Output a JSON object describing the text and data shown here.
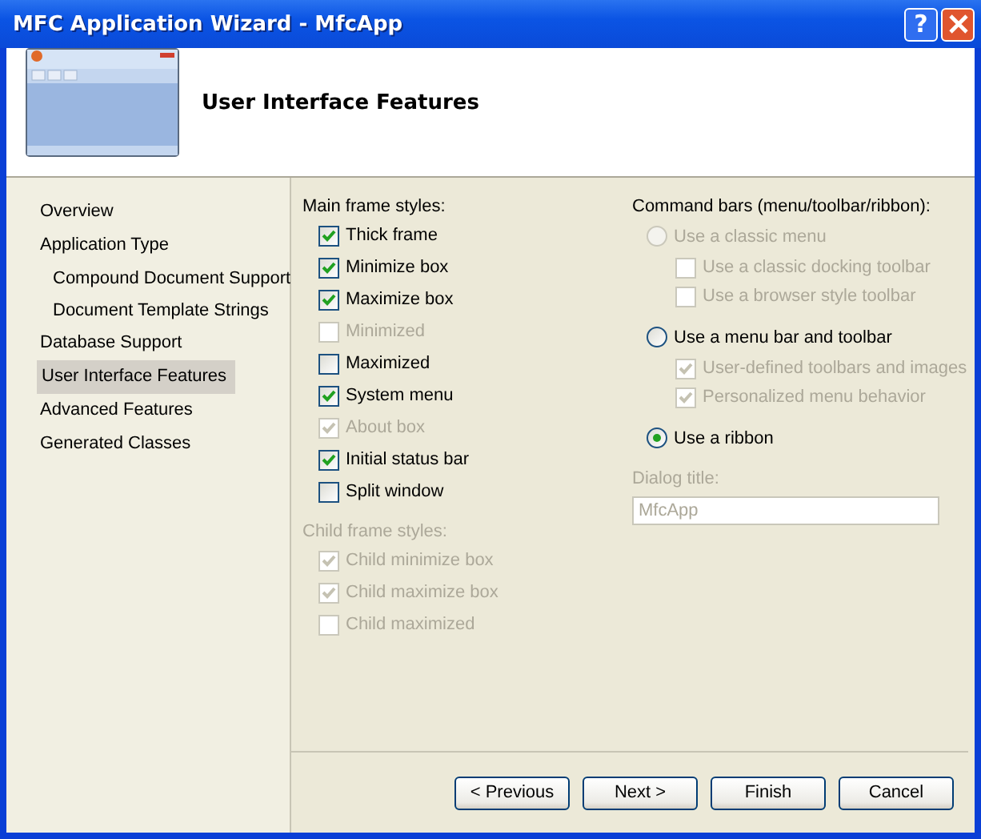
{
  "window": {
    "title": "MFC Application Wizard - MfcApp",
    "help_button": "?"
  },
  "header": {
    "title": "User Interface Features"
  },
  "sidebar": {
    "items": [
      {
        "label": "Overview",
        "selected": false
      },
      {
        "label": "Application Type",
        "selected": false,
        "children": [
          {
            "label": "Compound Document Support",
            "selected": false
          },
          {
            "label": "Document Template Strings",
            "selected": false
          }
        ]
      },
      {
        "label": "Database Support",
        "selected": false
      },
      {
        "label": "User Interface Features",
        "selected": true
      },
      {
        "label": "Advanced Features",
        "selected": false
      },
      {
        "label": "Generated Classes",
        "selected": false
      }
    ]
  },
  "main_frame_styles": {
    "label": "Main frame styles:",
    "disabled": false,
    "options": [
      {
        "label": "Thick frame",
        "checked": true,
        "disabled": false
      },
      {
        "label": "Minimize box",
        "checked": true,
        "disabled": false
      },
      {
        "label": "Maximize box",
        "checked": true,
        "disabled": false
      },
      {
        "label": "Minimized",
        "checked": false,
        "disabled": true
      },
      {
        "label": "Maximized",
        "checked": false,
        "disabled": false
      },
      {
        "label": "System menu",
        "checked": true,
        "disabled": false
      },
      {
        "label": "About box",
        "checked": true,
        "disabled": true
      },
      {
        "label": "Initial status bar",
        "checked": true,
        "disabled": false
      },
      {
        "label": "Split window",
        "checked": false,
        "disabled": false
      }
    ]
  },
  "child_frame_styles": {
    "label": "Child frame styles:",
    "disabled": true,
    "options": [
      {
        "label": "Child minimize box",
        "checked": true,
        "disabled": true
      },
      {
        "label": "Child maximize box",
        "checked": true,
        "disabled": true
      },
      {
        "label": "Child maximized",
        "checked": false,
        "disabled": true
      }
    ]
  },
  "command_bars": {
    "label": "Command bars (menu/toolbar/ribbon):",
    "options": [
      {
        "label": "Use a classic menu",
        "selected": false,
        "disabled": true,
        "children": [
          {
            "label": "Use a classic docking toolbar",
            "checked": false,
            "disabled": true
          },
          {
            "label": "Use a browser style toolbar",
            "checked": false,
            "disabled": true
          }
        ]
      },
      {
        "label": "Use a menu bar and toolbar",
        "selected": false,
        "disabled": false,
        "children": [
          {
            "label": "User-defined toolbars and images",
            "checked": true,
            "disabled": true
          },
          {
            "label": "Personalized menu behavior",
            "checked": true,
            "disabled": true
          }
        ]
      },
      {
        "label": "Use a ribbon",
        "selected": true,
        "disabled": false
      }
    ]
  },
  "dialog_title": {
    "label": "Dialog title:",
    "value": "MfcApp",
    "disabled": true
  },
  "buttons": [
    {
      "label": "< Previous"
    },
    {
      "label": "Next >"
    },
    {
      "label": "Finish"
    },
    {
      "label": "Cancel"
    }
  ]
}
